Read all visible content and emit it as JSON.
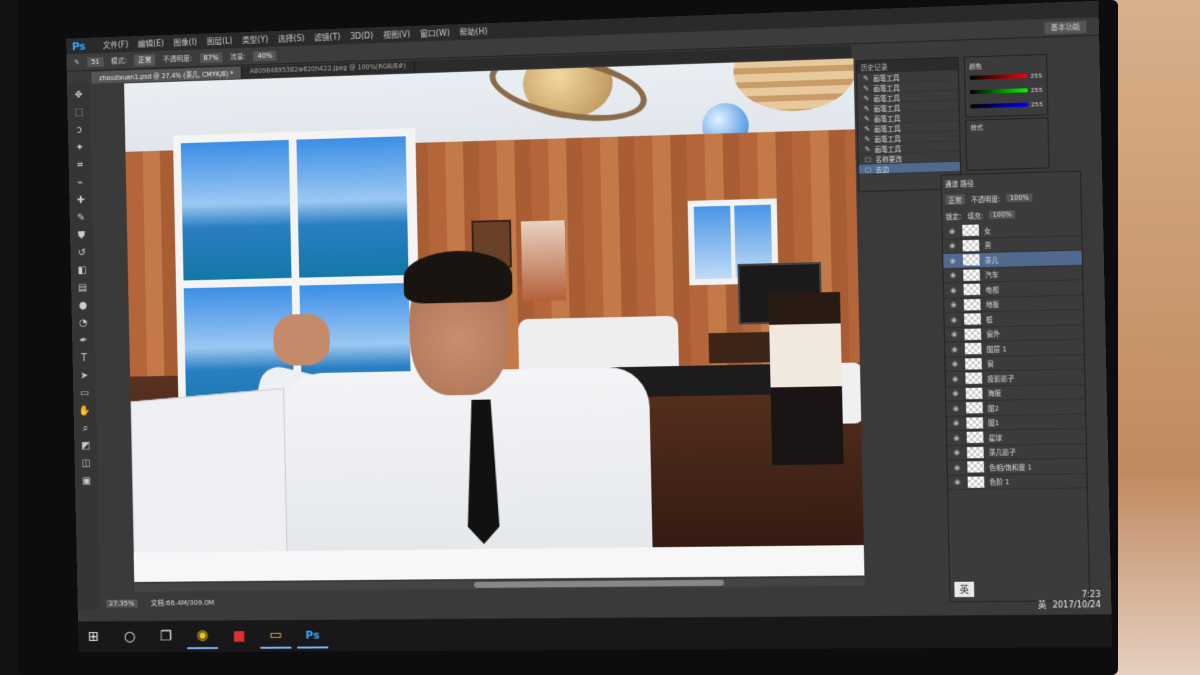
{
  "menubar": {
    "logo": "Ps",
    "items": [
      "文件(F)",
      "编辑(E)",
      "图像(I)",
      "图层(L)",
      "类型(Y)",
      "选择(S)",
      "滤镜(T)",
      "3D(D)",
      "视图(V)",
      "窗口(W)",
      "帮助(H)"
    ]
  },
  "options": {
    "brush_size": "51",
    "mode_label": "模式:",
    "mode_value": "正常",
    "opacity_label": "不透明度:",
    "opacity_value": "87%",
    "flow_label": "流量:",
    "flow_value": "40%",
    "workspace": "基本功能"
  },
  "tabs": [
    {
      "label": "zhouzixuan1.psd @ 27.4% (茶几, CMYK/8) *"
    },
    {
      "label": "A80984695382w620h422.jpeg @ 100%(RGB/8#)"
    }
  ],
  "status": {
    "zoom": "27.35%",
    "doc": "文档:66.4M/309.0M"
  },
  "history": {
    "title": "历史记录",
    "items": [
      "画笔工具",
      "画笔工具",
      "画笔工具",
      "画笔工具",
      "画笔工具",
      "画笔工具",
      "画笔工具",
      "画笔工具",
      "名称更改",
      "去边"
    ]
  },
  "color_panel": {
    "title": "颜色",
    "r": "255",
    "g": "255",
    "b": "255"
  },
  "styles_panel": {
    "title": "样式"
  },
  "layers": {
    "tabs": "通道 路径",
    "blend": "正常",
    "opacity_label": "不透明度:",
    "opacity_value": "100%",
    "lock_label": "锁定:",
    "fill_label": "填充:",
    "fill_value": "100%",
    "items": [
      "女",
      "男",
      "茶几",
      "汽车",
      "电视",
      "地板",
      "框",
      "窗外",
      "图层 1",
      "窗",
      "投影影子",
      "海报",
      "图2",
      "图1",
      "星球",
      "茶几影子",
      "色相/饱和度 1",
      "色阶 1"
    ],
    "ime": "英"
  },
  "tray": {
    "time": "7:23",
    "date": "2017/10/24",
    "ime": "英"
  },
  "taskbar": {
    "icons": [
      "windows-start-icon",
      "cortana-icon",
      "task-view-icon",
      "chrome-icon",
      "youdao-icon",
      "file-explorer-icon",
      "photoshop-icon"
    ]
  }
}
